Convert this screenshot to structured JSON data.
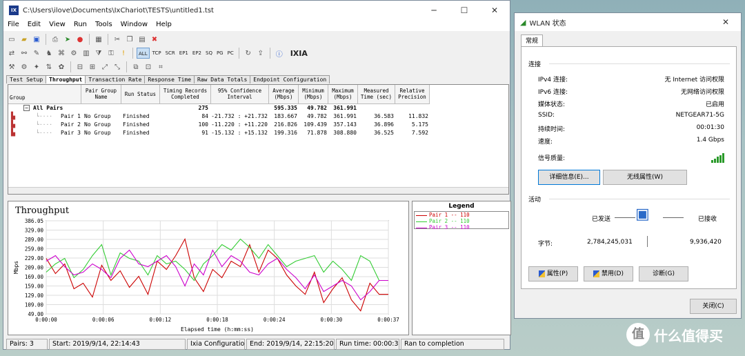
{
  "ixchariot": {
    "title": "C:\\Users\\ilove\\Documents\\IxChariot\\TESTS\\untitled1.tst",
    "menu": [
      "File",
      "Edit",
      "View",
      "Run",
      "Tools",
      "Window",
      "Help"
    ],
    "toolbar_text": [
      "ALL",
      "TCP",
      "SCR",
      "EP1",
      "EP2",
      "SQ",
      "PG",
      "PC"
    ],
    "brand": "IXIA",
    "tabs": [
      "Test Setup",
      "Throughput",
      "Transaction Rate",
      "Response Time",
      "Raw Data Totals",
      "Endpoint Configuration"
    ],
    "columns": [
      "Group",
      "Pair Group Name",
      "Run Status",
      "Timing Records Completed",
      "95% Confidence Interval",
      "Average (Mbps)",
      "Minimum (Mbps)",
      "Maximum (Mbps)",
      "Measured Time (sec)",
      "Relative Precision"
    ],
    "all_pairs": {
      "label": "All Pairs",
      "records": "275",
      "average": "595.335",
      "minimum": "49.782",
      "maximum": "361.991"
    },
    "rows": [
      {
        "name": "Pair 1",
        "group": "No Group",
        "status": "Finished",
        "records": "84",
        "ci": "-21.732 : +21.732",
        "avg": "183.667",
        "min": "49.782",
        "max": "361.991",
        "time": "36.583",
        "prec": "11.832"
      },
      {
        "name": "Pair 2",
        "group": "No Group",
        "status": "Finished",
        "records": "100",
        "ci": "-11.220 : +11.220",
        "avg": "216.826",
        "min": "109.439",
        "max": "357.143",
        "time": "36.896",
        "prec": "5.175"
      },
      {
        "name": "Pair 3",
        "group": "No Group",
        "status": "Finished",
        "records": "91",
        "ci": "-15.132 : +15.132",
        "avg": "199.316",
        "min": "71.878",
        "max": "308.880",
        "time": "36.525",
        "prec": "7.592"
      }
    ],
    "legend_title": "Legend",
    "status": {
      "pairs": "Pairs: 3",
      "start": "Start: 2019/9/14, 22:14:43",
      "config": "Ixia Configuratio",
      "end": "End: 2019/9/14, 22:15:20",
      "run_time": "Run time: 00:00:37",
      "completion": "Ran to completion"
    }
  },
  "chart_data": {
    "type": "line",
    "title": "Throughput",
    "xlabel": "Elapsed time (h:mm:ss)",
    "ylabel": "Mbps",
    "x_ticks": [
      "0:00:00",
      "0:00:06",
      "0:00:12",
      "0:00:18",
      "0:00:24",
      "0:00:30",
      "0:00:37"
    ],
    "y_ticks": [
      "386.05",
      "329.00",
      "289.00",
      "259.00",
      "229.00",
      "209.00",
      "169.00",
      "159.00",
      "129.00",
      "109.00",
      "49.00"
    ],
    "xlim_sec": [
      0,
      37
    ],
    "ylim": [
      49,
      386.05
    ],
    "colors": {
      "Pair 1": "#cc0000",
      "Pair 2": "#33cc33",
      "Pair 3": "#cc00cc"
    },
    "series": [
      {
        "name": "Pair 1 -- 110",
        "x": [
          0,
          1,
          2,
          3,
          4,
          5,
          6,
          7,
          8,
          9,
          10,
          11,
          12,
          13,
          14,
          15,
          16,
          17,
          18,
          19,
          20,
          21,
          22,
          23,
          24,
          25,
          26,
          27,
          28,
          29,
          30,
          31,
          32,
          33,
          34,
          35,
          36,
          37
        ],
        "values": [
          250,
          195,
          230,
          140,
          160,
          110,
          225,
          170,
          205,
          145,
          185,
          120,
          240,
          210,
          260,
          320,
          180,
          130,
          210,
          180,
          240,
          220,
          300,
          200,
          280,
          250,
          190,
          150,
          120,
          200,
          90,
          140,
          180,
          100,
          60,
          160,
          120,
          120
        ]
      },
      {
        "name": "Pair 2 -- 110",
        "x": [
          0,
          1,
          2,
          3,
          4,
          5,
          6,
          7,
          8,
          9,
          10,
          11,
          12,
          13,
          14,
          15,
          16,
          17,
          18,
          19,
          20,
          21,
          22,
          23,
          24,
          25,
          26,
          27,
          28,
          29,
          30,
          31,
          32,
          33,
          34,
          35,
          36,
          37
        ],
        "values": [
          200,
          230,
          250,
          180,
          210,
          260,
          300,
          190,
          270,
          250,
          240,
          190,
          260,
          230,
          240,
          210,
          170,
          230,
          260,
          300,
          280,
          320,
          290,
          250,
          300,
          260,
          220,
          240,
          250,
          260,
          200,
          240,
          210,
          170,
          260,
          240,
          170,
          170
        ]
      },
      {
        "name": "Pair 3 -- 110",
        "x": [
          0,
          1,
          2,
          3,
          4,
          5,
          6,
          7,
          8,
          9,
          10,
          11,
          12,
          13,
          14,
          15,
          16,
          17,
          18,
          19,
          20,
          21,
          22,
          23,
          24,
          25,
          26,
          27,
          28,
          29,
          30,
          31,
          32,
          33,
          34,
          35,
          36,
          37
        ],
        "values": [
          240,
          260,
          220,
          190,
          200,
          230,
          210,
          180,
          250,
          280,
          230,
          220,
          240,
          260,
          220,
          150,
          230,
          190,
          280,
          220,
          260,
          240,
          200,
          190,
          230,
          250,
          210,
          180,
          140,
          190,
          130,
          150,
          170,
          150,
          100,
          130,
          170,
          170
        ]
      }
    ]
  },
  "wlan": {
    "title": "WLAN 状态",
    "tab": "常规",
    "section_connection": "连接",
    "rows": [
      {
        "k": "IPv4 连接:",
        "v": "无 Internet 访问权限"
      },
      {
        "k": "IPv6 连接:",
        "v": "无网络访问权限"
      },
      {
        "k": "媒体状态:",
        "v": "已启用"
      },
      {
        "k": "SSID:",
        "v": "NETGEAR71-5G"
      },
      {
        "k": "持续时间:",
        "v": "00:01:30"
      },
      {
        "k": "速度:",
        "v": "1.4 Gbps"
      }
    ],
    "signal_label": "信号质量:",
    "signal_bars": 5,
    "details_button": "详细信息(E)...",
    "wireless_props_button": "无线属性(W)",
    "section_activity": "活动",
    "sent_label": "已发送",
    "received_label": "已接收",
    "bytes_label": "字节:",
    "bytes_sent": "2,784,245,031",
    "bytes_received": "9,936,420",
    "properties_button": "属性(P)",
    "disable_button": "禁用(D)",
    "diagnose_button": "诊断(G)",
    "close_button": "关闭(C)"
  },
  "watermark": {
    "text": "什么值得买",
    "logo": "值"
  }
}
